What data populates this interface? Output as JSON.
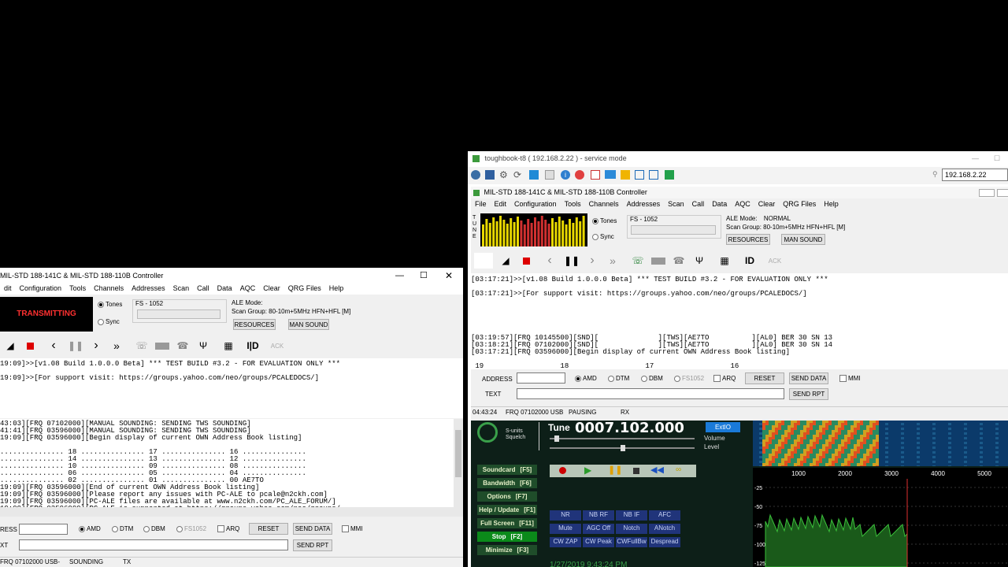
{
  "left_window": {
    "title": "MIL-STD 188-141C & MIL-STD 188-110B Controller",
    "menu": [
      "dit",
      "Configuration",
      "Tools",
      "Channels",
      "Addresses",
      "Scan",
      "Call",
      "Data",
      "AQC",
      "Clear",
      "QRG Files",
      "Help"
    ],
    "transmit_label": "TRANSMITTING",
    "tones_label": "Tones",
    "sync_label": "Sync",
    "fs_label": "FS - 1052",
    "ale_mode_label": "ALE Mode:",
    "scan_group": "Scan Group: 80-10m+5MHz HFN+HFL [M]",
    "resources_btn": "RESOURCES",
    "mansound_btn": "MAN SOUND",
    "log_top": [
      "19:09]>>[v1.08 Build 1.0.0.0 Beta] *** TEST BUILD #3.2 - FOR EVALUATION ONLY ***",
      "",
      "19:09]>>[For support visit: https://groups.yahoo.com/neo/groups/PCALEDOCS/]"
    ],
    "log_bottom": [
      "43:03][FRQ 07102000][MANUAL SOUNDING: SENDING TWS SOUNDING]",
      "41:41][FRQ 03596000][MANUAL SOUNDING: SENDING TWS SOUNDING]",
      "19:09][FRQ 03596000][Begin display of current OWN Address Book listing]",
      "",
      "............... 18 ............... 17 ............... 16 ...............",
      "............... 14 ............... 13 ............... 12 ...............",
      "............... 10 ............... 09 ............... 08 ...............",
      "............... 06 ............... 05 ............... 04 ...............",
      "............... 02 ............... 01 ............... 00 AE7TO",
      "19:09][FRQ 03596000][End of current OWN Address Book listing]",
      "19:09][FRQ 03596000][Please report any issues with PC-ALE to pcale@n2ckh.com]",
      "19:09][FRQ 03596000][PC-ALE files are available at www.n2ckh.com/PC_ALE_FORUM/]",
      "19:09][FRQ 03596000][PC-ALE is supported at https://groups.yahoo.com/neo/groups/"
    ],
    "address_label": "RESS",
    "text_label": "XT",
    "amd": "AMD",
    "dtm": "DTM",
    "dbm": "DBM",
    "fs1052": "FS1052",
    "arq": "ARQ",
    "reset_btn": "RESET",
    "send_data_btn": "SEND DATA",
    "mmi": "MMI",
    "send_rpt_btn": "SEND RPT",
    "status_freq": "FRQ 07102000 USB-",
    "status_state": "SOUNDING",
    "status_tx": "TX"
  },
  "remote_window": {
    "title": "toughbook-t8 ( 192.168.2.22 ) - service mode",
    "ip_value": "192.168.2.22"
  },
  "right_window": {
    "title": "MIL-STD 188-141C & MIL-STD 188-110B Controller",
    "menu": [
      "File",
      "Edit",
      "Configuration",
      "Tools",
      "Channels",
      "Addresses",
      "Scan",
      "Call",
      "Data",
      "AQC",
      "Clear",
      "QRG Files",
      "Help"
    ],
    "tune_label": "TUNE",
    "tones_label": "Tones",
    "sync_label": "Sync",
    "fs_label": "FS - 1052",
    "ale_mode_label": "ALE Mode:",
    "ale_mode_value": "NORMAL",
    "scan_group": "Scan Group: 80-10m+5MHz HFN+HFL [M]",
    "resources_btn": "RESOURCES",
    "mansound_btn": "MAN SOUND",
    "id_btn": "ID",
    "ack_btn": "ACK",
    "log_top": [
      "[03:17:21]>>[v1.08 Build 1.0.0.0 Beta] *** TEST BUILD #3.2 - FOR EVALUATION ONLY ***",
      "",
      "[03:17:21]>>[For support visit: https://groups.yahoo.com/neo/groups/PCALEDOCS/]"
    ],
    "log_bottom": [
      "[03:19:57][FRQ 10145500][SND][              ][TWS][AE7TO          ][AL0] BER 30 SN 13",
      "[03:18:21][FRQ 07102000][SND][              ][TWS][AE7TO          ][AL0] BER 30 SN 14",
      "[03:17:21][FRQ 03596000][Begin display of current OWN Address Book listing]",
      "",
      " 19                  18                  17                  16"
    ],
    "address_label": "ADDRESS",
    "text_label": "TEXT",
    "amd": "AMD",
    "dtm": "DTM",
    "dbm": "DBM",
    "fs1052": "FS1052",
    "arq": "ARQ",
    "reset_btn": "RESET",
    "send_data_btn": "SEND DATA",
    "mmi": "MMI",
    "send_rpt_btn": "SEND RPT",
    "status_time": "04:43:24",
    "status_freq": "FRQ 07102000 USB",
    "status_state": "PAUSING",
    "status_rx": "RX"
  },
  "sdr": {
    "smeter_label": "S-units Squelch",
    "tune_label": "Tune",
    "freq": "0007.102.000",
    "extio": "ExtIO",
    "volume": "Volume",
    "level": "Level",
    "buttons": [
      {
        "label": "Soundcard",
        "key": "[F5]"
      },
      {
        "label": "Bandwidth",
        "key": "[F6]"
      },
      {
        "label": "Options",
        "key": "[F7]"
      },
      {
        "label": "Help / Update",
        "key": "[F1]"
      },
      {
        "label": "Full Screen",
        "key": "[F11]"
      },
      {
        "label": "Stop",
        "key": "[F2]"
      },
      {
        "label": "Minimize",
        "key": "[F3]"
      }
    ],
    "dsp": [
      "NR",
      "NB RF",
      "NB IF",
      "AFC",
      "Mute",
      "AGC Off",
      "Notch",
      "ANotch",
      "CW ZAP",
      "CW Peak",
      "CWFullBw",
      "Despread"
    ],
    "freq_ticks": [
      "1000",
      "2000",
      "3000",
      "4000",
      "5000"
    ],
    "db_ticks": [
      "-25",
      "-50",
      "-75",
      "-100",
      "-125"
    ],
    "date_text": "1/27/2019 9:43:24 PM"
  }
}
